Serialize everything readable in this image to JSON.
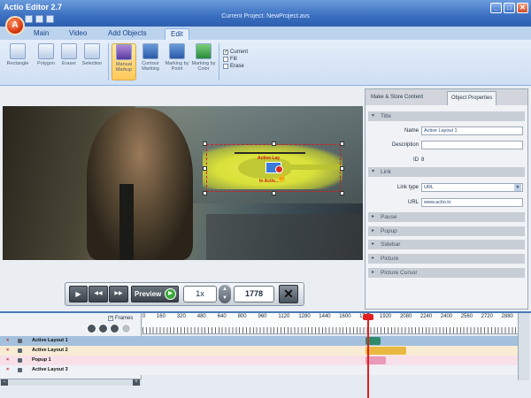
{
  "window": {
    "app_title": "Actio Editor 2.7",
    "project_title": "Current Project: NewProject.avs",
    "buttons": [
      "_",
      "□",
      "✕"
    ]
  },
  "ribbon": {
    "tabs": [
      "Main",
      "Video",
      "Add Objects",
      "Edit"
    ],
    "active_tab": "Edit",
    "tools_disabled": [
      "Rectangle",
      "Polygon",
      "Eraser",
      "Selection"
    ],
    "tools_marking": [
      {
        "label": "Manual Markup",
        "icon": "manual-markup-icon",
        "active": true
      },
      {
        "label": "Contour Marking",
        "icon": "contour-marking-icon",
        "active": false
      },
      {
        "label": "Marking by Point",
        "icon": "marking-point-icon",
        "active": false
      },
      {
        "label": "Marking by Color",
        "icon": "marking-color-icon",
        "active": false
      }
    ],
    "options": [
      {
        "label": "Current",
        "checked": true
      },
      {
        "label": "Fill",
        "checked": false
      },
      {
        "label": "Erase",
        "checked": false
      }
    ]
  },
  "video": {
    "marker_label": "Active Lay",
    "marker_label2": "In Activ..."
  },
  "player": {
    "preview_label": "Preview",
    "speed": "1x",
    "frame": "1778",
    "glyphs": {
      "play": "▶",
      "rewind": "◀◀",
      "forward": "▶▶",
      "go": "▶",
      "up": "▲",
      "down": "▼",
      "stop": "✕"
    }
  },
  "properties": {
    "tabs": [
      "Make & Store Content",
      "Object Properties"
    ],
    "active_tab": "Object Properties",
    "title_section": "Title",
    "name_label": "Name",
    "name_value": "Active Layout 1",
    "description_label": "Description",
    "description_value": "",
    "id_label": "ID",
    "id_value": "8",
    "link_section": "Link",
    "link_type_label": "Link type",
    "link_type_value": "URL",
    "url_label": "URL",
    "url_value": "www.actio.tv",
    "collapsed_sections": [
      "Pause",
      "Popup",
      "Sidebar",
      "Picture",
      "Picture Cursor"
    ]
  },
  "timeline": {
    "frames_label": "Frames",
    "frames_checked": true,
    "ruler_labels": [
      "0",
      "160",
      "320",
      "480",
      "640",
      "800",
      "960",
      "1120",
      "1280",
      "1440",
      "1600",
      "1760",
      "1920",
      "2080",
      "2240",
      "2400",
      "2560",
      "2720",
      "2880"
    ],
    "current_frame": 1778,
    "layers": [
      {
        "name": "Active Layout 1",
        "selected": true,
        "bar_color": "#2e8a6a",
        "start": 1760,
        "end": 1880
      },
      {
        "name": "Active Layout 2",
        "selected": false,
        "bar_color": "#e8b840",
        "start": 1760,
        "end": 2080
      },
      {
        "name": "Popup 1",
        "selected": false,
        "bar_color": "#e89ab8",
        "start": 1760,
        "end": 1920
      },
      {
        "name": "Active Layout 3",
        "selected": false,
        "bar_color": "#c0d0e0",
        "start": 0,
        "end": 0
      }
    ],
    "row_colors": [
      "#a4c0dc",
      "#f8ecd4",
      "#f8e0e8",
      "#eef1f5"
    ]
  },
  "colors": {
    "accent": "#4a7ab8",
    "playhead": "#e02020",
    "selection": "#cc2020",
    "mask": "#e8ec4a"
  }
}
